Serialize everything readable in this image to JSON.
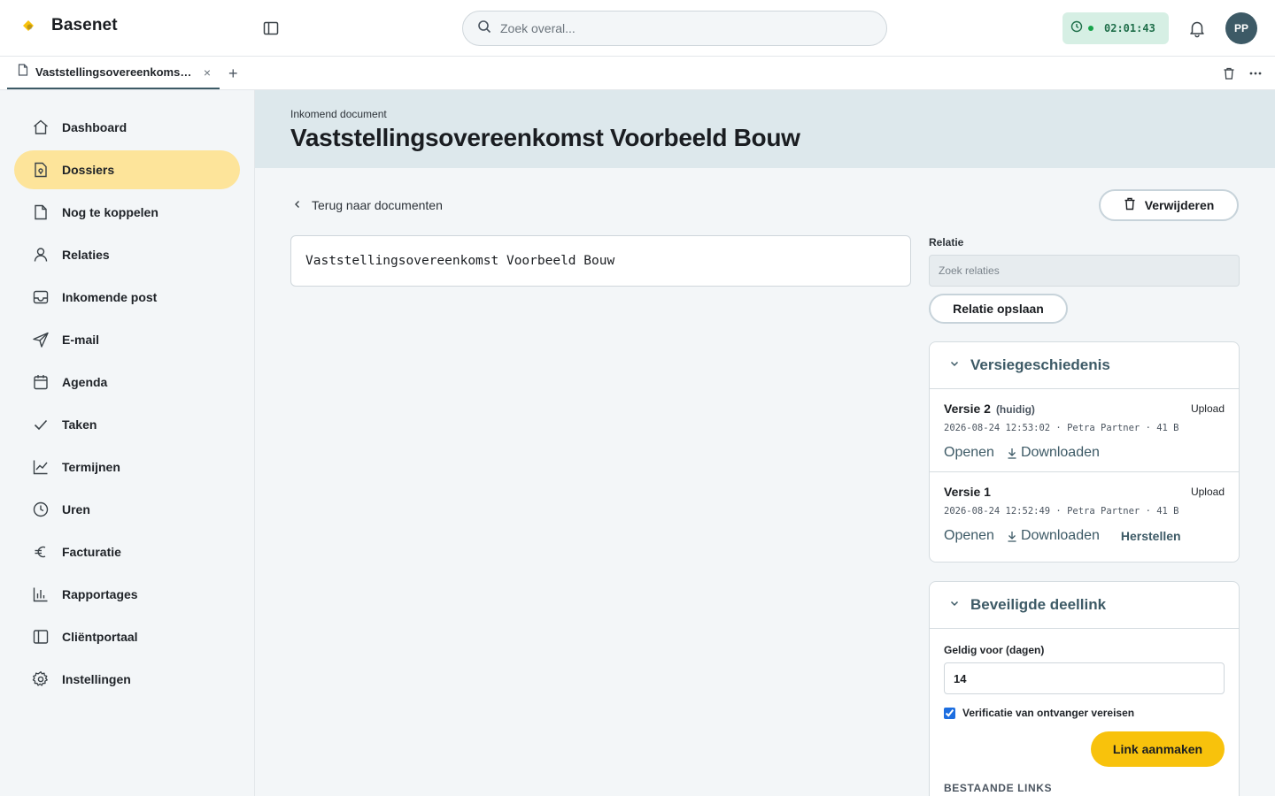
{
  "app": {
    "name": "Basenet",
    "brand_color": "#f8c20c",
    "accent_color": "#3d5a66"
  },
  "search": {
    "placeholder": "Zoek overal..."
  },
  "timer": {
    "value": "02:01:43"
  },
  "user": {
    "initials": "PP"
  },
  "tabs": [
    {
      "label": "Vaststellingsovereenkomst Voorbeeld Bouw"
    }
  ],
  "sidebar": {
    "items": [
      {
        "label": "Dashboard",
        "icon": "home-icon"
      },
      {
        "label": "Dossiers",
        "icon": "folder-document-icon",
        "active": true
      },
      {
        "label": "Nog te koppelen",
        "icon": "file-icon"
      },
      {
        "label": "Relaties",
        "icon": "user-icon"
      },
      {
        "label": "Inkomende post",
        "icon": "inbox-icon"
      },
      {
        "label": "E-mail",
        "icon": "send-icon"
      },
      {
        "label": "Agenda",
        "icon": "calendar-icon"
      },
      {
        "label": "Taken",
        "icon": "check-icon"
      },
      {
        "label": "Termijnen",
        "icon": "chart-line-icon"
      },
      {
        "label": "Uren",
        "icon": "clock-icon"
      },
      {
        "label": "Facturatie",
        "icon": "euro-icon"
      },
      {
        "label": "Rapportages",
        "icon": "bar-chart-icon"
      },
      {
        "label": "Cliëntportaal",
        "icon": "portal-icon"
      },
      {
        "label": "Instellingen",
        "icon": "gear-icon"
      }
    ]
  },
  "header": {
    "eyebrow": "Inkomend document",
    "title": "Vaststellingsovereenkomst Voorbeeld Bouw"
  },
  "back_link": "Terug naar documenten",
  "delete_label": "Verwijderen",
  "document": {
    "title_value": "Vaststellingsovereenkomst Voorbeeld Bouw"
  },
  "relation": {
    "label": "Relatie",
    "placeholder": "Zoek relaties",
    "save_label": "Relatie opslaan"
  },
  "versions": {
    "title": "Versiegeschiedenis",
    "items": [
      {
        "name": "Versie 2",
        "current": "(huidig)",
        "type": "Upload",
        "meta": "2026-08-24 12:53:02 · Petra Partner · 41 B",
        "open": "Openen",
        "download": "Downloaden"
      },
      {
        "name": "Versie 1",
        "type": "Upload",
        "meta": "2026-08-24 12:52:49 · Petra Partner · 41 B",
        "open": "Openen",
        "download": "Downloaden",
        "restore": "Herstellen"
      }
    ]
  },
  "share": {
    "title": "Beveiligde deellink",
    "days_label": "Geldig voor (dagen)",
    "days_value": "14",
    "verify_label": "Verificatie van ontvanger vereisen",
    "verify_checked": true,
    "create_label": "Link aanmaken",
    "existing_label": "BESTAANDE LINKS"
  }
}
